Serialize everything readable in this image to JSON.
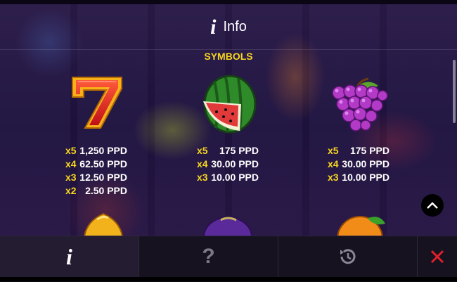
{
  "header": {
    "title": "Info",
    "info_icon": "info-icon"
  },
  "section": {
    "title": "SYMBOLS"
  },
  "symbols": [
    {
      "name": "seven",
      "pays": [
        {
          "mult": "x5",
          "amount": "1,250 PPD"
        },
        {
          "mult": "x4",
          "amount": "62.50 PPD"
        },
        {
          "mult": "x3",
          "amount": "12.50 PPD"
        },
        {
          "mult": "x2",
          "amount": "2.50 PPD"
        }
      ]
    },
    {
      "name": "watermelon",
      "pays": [
        {
          "mult": "x5",
          "amount": "175 PPD"
        },
        {
          "mult": "x4",
          "amount": "30.00 PPD"
        },
        {
          "mult": "x3",
          "amount": "10.00 PPD"
        }
      ]
    },
    {
      "name": "grapes",
      "pays": [
        {
          "mult": "x5",
          "amount": "175 PPD"
        },
        {
          "mult": "x4",
          "amount": "30.00 PPD"
        },
        {
          "mult": "x3",
          "amount": "10.00 PPD"
        }
      ]
    }
  ],
  "tabs": {
    "info": {
      "icon": "info-icon",
      "glyph": "i"
    },
    "help": {
      "icon": "question-icon",
      "glyph": "?"
    },
    "history": {
      "icon": "history-icon"
    },
    "close": {
      "icon": "close-icon"
    }
  },
  "colors": {
    "accent_yellow": "#f6d51f",
    "close_red": "#e0202a"
  }
}
